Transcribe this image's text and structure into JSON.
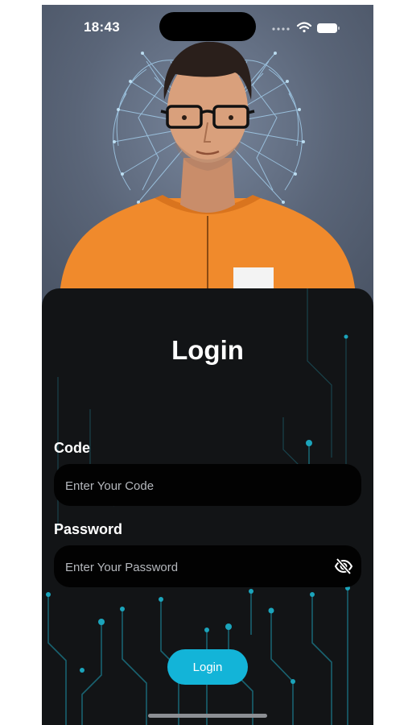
{
  "status_bar": {
    "time": "18:43",
    "icons": [
      "cellular-dots-icon",
      "wifi-icon",
      "battery-icon"
    ]
  },
  "hero": {
    "image": "person-avatar-illustration"
  },
  "login_form": {
    "title": "Login",
    "code_label": "Code",
    "code_placeholder": "Enter Your Code",
    "code_value": "",
    "password_label": "Password",
    "password_placeholder": "Enter Your Password",
    "password_value": "",
    "password_toggle_icon": "eye-slash-icon",
    "submit_label": "Login"
  },
  "colors": {
    "accent": "#13b4d8",
    "card_background": "#121416",
    "field_background": "#020202",
    "hero_background": "#5f6a7c"
  }
}
